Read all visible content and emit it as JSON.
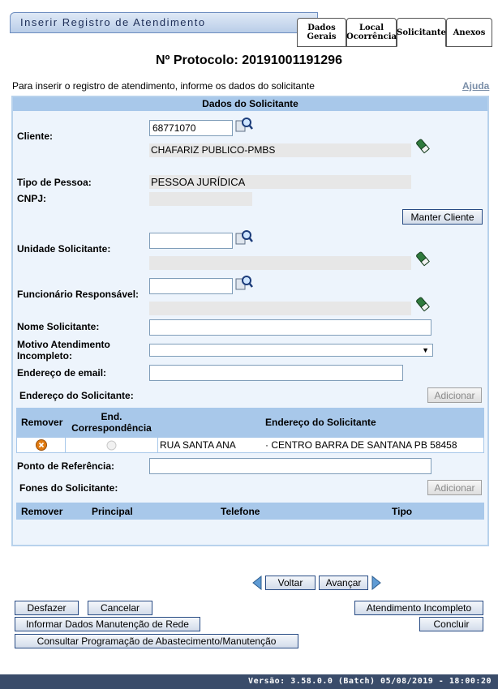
{
  "window": {
    "title": "Inserir Registro de Atendimento"
  },
  "tabs": [
    {
      "label_line1": "Dados",
      "label_line2": "Gerais"
    },
    {
      "label_line1": "Local",
      "label_line2": "Ocorrência"
    },
    {
      "label_line1": "Solicitante",
      "label_line2": ""
    },
    {
      "label_line1": "Anexos",
      "label_line2": ""
    }
  ],
  "protocol": "Nº Protocolo: 20191001191296",
  "instructions": "Para inserir o registro de atendimento, informe os dados do solicitante",
  "help_link": "Ajuda",
  "section_title": "Dados do Solicitante",
  "form": {
    "cliente_label": "Cliente:",
    "cliente_code": "68771070",
    "cliente_name": "CHAFARIZ PUBLICO-PMBS",
    "tipo_pessoa_label": "Tipo de Pessoa:",
    "tipo_pessoa_value": "PESSOA JURÍDICA",
    "cnpj_label": "CNPJ:",
    "cnpj_value": "",
    "manter_cliente": "Manter Cliente",
    "unidade_label": "Unidade Solicitante:",
    "unidade_code": "",
    "unidade_name": "",
    "funcionario_label": "Funcionário Responsável:",
    "funcionario_code": "",
    "funcionario_name": "",
    "nome_label": "Nome Solicitante:",
    "nome_value": "",
    "motivo_label_line1": "Motivo Atendimento",
    "motivo_label_line2": "Incompleto:",
    "motivo_value": "",
    "email_label": "Endereço de email:",
    "email_value": "",
    "endereco_label": "Endereço do Solicitante:",
    "adicionar": "Adicionar",
    "ponto_label": "Ponto de Referência:",
    "ponto_value": "",
    "fones_label": "Fones do Solicitante:"
  },
  "address_table": {
    "headers": {
      "remover": "Remover",
      "end_corr_line1": "End.",
      "end_corr_line2": "Correspondência",
      "endereco": "Endereço do Solicitante"
    },
    "rows": [
      {
        "street": "RUA SANTA ANA",
        "rest": "· CENTRO BARRA DE SANTANA PB 58458"
      }
    ]
  },
  "phones_table": {
    "headers": {
      "remover": "Remover",
      "principal": "Principal",
      "telefone": "Telefone",
      "tipo": "Tipo"
    }
  },
  "navigation": {
    "voltar": "Voltar",
    "avancar": "Avançar"
  },
  "actions": {
    "desfazer": "Desfazer",
    "cancelar": "Cancelar",
    "atendimento_incompleto": "Atendimento Incompleto",
    "informar_dados": "Informar Dados Manutenção de Rede",
    "concluir": "Concluir",
    "consultar": "Consultar Programação de Abastecimento/Manutenção"
  },
  "footer": "Versão: 3.58.0.0 (Batch) 05/08/2019 - 18:00:20",
  "colors": {
    "panel_bg": "#edf4fc",
    "header_bg": "#a8c8ea",
    "footer_bg": "#3a4c6a",
    "remove_icon": "#e07b12"
  }
}
